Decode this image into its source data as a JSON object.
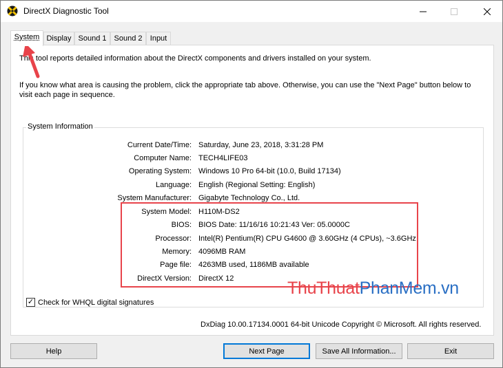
{
  "window": {
    "title": "DirectX Diagnostic Tool",
    "minimize_glyph": "—",
    "maximize_glyph": "☐",
    "close_glyph": "✕"
  },
  "tabs": [
    {
      "label": "System",
      "active": true
    },
    {
      "label": "Display",
      "active": false
    },
    {
      "label": "Sound 1",
      "active": false
    },
    {
      "label": "Sound 2",
      "active": false
    },
    {
      "label": "Input",
      "active": false
    }
  ],
  "intro": {
    "line1": "This tool reports detailed information about the DirectX components and drivers installed on your system.",
    "line2": "If you know what area is causing the problem, click the appropriate tab above.  Otherwise, you can use the \"Next Page\" button below to visit each page in sequence."
  },
  "system_info": {
    "group_title": "System Information",
    "rows": [
      {
        "label": "Current Date/Time:",
        "value": "Saturday, June 23, 2018, 3:31:28 PM"
      },
      {
        "label": "Computer Name:",
        "value": "TECH4LIFE03"
      },
      {
        "label": "Operating System:",
        "value": "Windows 10 Pro 64-bit (10.0, Build 17134)"
      },
      {
        "label": "Language:",
        "value": "English (Regional Setting: English)"
      },
      {
        "label": "System Manufacturer:",
        "value": "Gigabyte Technology Co., Ltd."
      },
      {
        "label": "System Model:",
        "value": "H110M-DS2"
      },
      {
        "label": "BIOS:",
        "value": "BIOS Date: 11/16/16 10:21:43 Ver: 05.0000C"
      },
      {
        "label": "Processor:",
        "value": "Intel(R) Pentium(R) CPU G4600 @ 3.60GHz (4 CPUs), ~3.6GHz"
      },
      {
        "label": "Memory:",
        "value": "4096MB RAM"
      },
      {
        "label": "Page file:",
        "value": "4263MB used, 1186MB available"
      },
      {
        "label": "DirectX Version:",
        "value": "DirectX 12"
      }
    ]
  },
  "whql": {
    "label": "Check for WHQL digital signatures",
    "checked": true,
    "check_glyph": "✓"
  },
  "watermark": {
    "part1": "ThuThuat",
    "part2": "PhanMem",
    "part3": ".vn",
    "colors": {
      "part1": "#e8434a",
      "part2": "#2a6fc4",
      "part3": "#2a6fc4"
    }
  },
  "footer": {
    "version_text": "DxDiag 10.00.17134.0001 64-bit Unicode  Copyright © Microsoft. All rights reserved."
  },
  "buttons": {
    "help": "Help",
    "next_page": "Next Page",
    "save_all": "Save All Information...",
    "exit": "Exit"
  },
  "colors": {
    "highlight": "#e8434a",
    "arrow": "#e8434a",
    "accent": "#0078d7"
  }
}
